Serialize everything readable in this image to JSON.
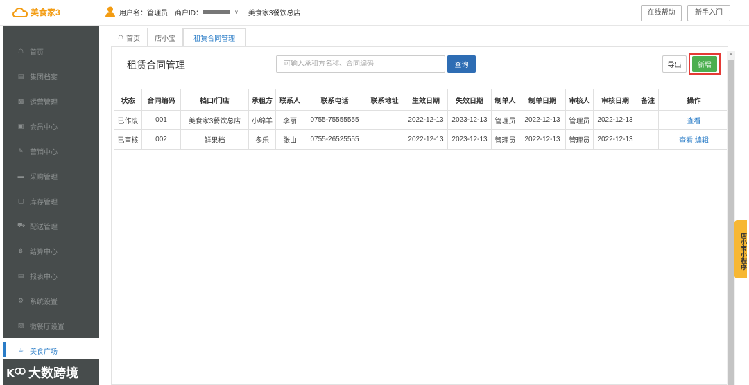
{
  "app": {
    "logo_text": "美食家3"
  },
  "user": {
    "username_label": "用户名：",
    "username": "管理员",
    "merchant_label": "商户ID：",
    "store_name": "美食家3餐饮总店"
  },
  "top_buttons": {
    "help": "在线帮助",
    "guide": "新手入门"
  },
  "sidebar": {
    "items": [
      {
        "label": "首页",
        "icon": "home-icon"
      },
      {
        "label": "集团档案",
        "icon": "file-icon"
      },
      {
        "label": "运营管理",
        "icon": "chart-icon"
      },
      {
        "label": "会员中心",
        "icon": "card-icon"
      },
      {
        "label": "营销中心",
        "icon": "edit-icon"
      },
      {
        "label": "采购管理",
        "icon": "cart-icon"
      },
      {
        "label": "库存管理",
        "icon": "box-icon"
      },
      {
        "label": "配送管理",
        "icon": "truck-icon"
      },
      {
        "label": "结算中心",
        "icon": "currency-icon"
      },
      {
        "label": "报表中心",
        "icon": "report-icon"
      },
      {
        "label": "系统设置",
        "icon": "gear-icon"
      },
      {
        "label": "微餐厅设置",
        "icon": "restaurant-icon"
      },
      {
        "label": "美食广场",
        "icon": "food-court-icon",
        "active": true
      }
    ]
  },
  "watermark": {
    "text": "大数跨境"
  },
  "breadcrumb": {
    "home": "首页",
    "store": "店小宝",
    "current": "租赁合同管理"
  },
  "page": {
    "title": "租赁合同管理",
    "search_placeholder": "可输入承租方名称、合同编码",
    "query_label": "查询",
    "export_label": "导出",
    "new_label": "新增"
  },
  "table": {
    "headers": [
      "状态",
      "合同编码",
      "档口/门店",
      "承租方",
      "联系人",
      "联系电话",
      "联系地址",
      "生效日期",
      "失效日期",
      "制单人",
      "制单日期",
      "审核人",
      "审核日期",
      "备注",
      "操作"
    ],
    "rows": [
      {
        "status": "已作废",
        "code": "001",
        "store": "美食家3餐饮总店",
        "lessee": "小绵羊",
        "contact": "李丽",
        "phone": "0755-75555555",
        "address": "",
        "start": "2022-12-13",
        "end": "2023-12-13",
        "creator": "管理员",
        "created": "2022-12-13",
        "auditor": "管理员",
        "audited": "2022-12-13",
        "remark": "",
        "actions": [
          "查看"
        ]
      },
      {
        "status": "已审核",
        "code": "002",
        "store": "鲜果档",
        "lessee": "多乐",
        "contact": "张山",
        "phone": "0755-26525555",
        "address": "",
        "start": "2022-12-13",
        "end": "2023-12-13",
        "creator": "管理员",
        "created": "2022-12-13",
        "auditor": "管理员",
        "audited": "2022-12-13",
        "remark": "",
        "actions": [
          "查看",
          "编辑"
        ]
      }
    ]
  },
  "float_tab": {
    "label": "店小宝小程序"
  },
  "colors": {
    "accent": "#2a7cc7",
    "new_button": "#4caf50",
    "highlight_border": "#e53935",
    "sidebar_bg": "#474c4c",
    "logo": "#f39c12",
    "float_tab": "#f7b733"
  }
}
